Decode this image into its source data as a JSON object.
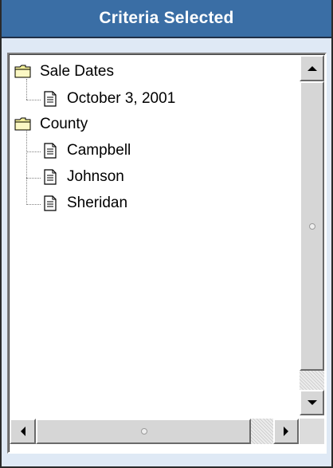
{
  "panel": {
    "title": "Criteria Selected"
  },
  "tree": {
    "nodes": [
      {
        "type": "folder",
        "label": "Sale Dates",
        "level": 0
      },
      {
        "type": "item",
        "label": "October 3, 2001",
        "level": 1
      },
      {
        "type": "folder",
        "label": "County",
        "level": 0
      },
      {
        "type": "item",
        "label": "Campbell",
        "level": 1
      },
      {
        "type": "item",
        "label": "Johnson",
        "level": 1
      },
      {
        "type": "item",
        "label": "Sheridan",
        "level": 1
      }
    ]
  },
  "icons": {
    "folder": "folder-icon",
    "item": "document-icon",
    "scroll_up": "arrow-up-icon",
    "scroll_down": "arrow-down-icon",
    "scroll_left": "arrow-left-icon",
    "scroll_right": "arrow-right-icon"
  },
  "colors": {
    "title_bar": "#3a6ea5",
    "title_text": "#ffffff",
    "panel_background": "#dfe9f5",
    "folder_fill": "#f5f19a"
  }
}
